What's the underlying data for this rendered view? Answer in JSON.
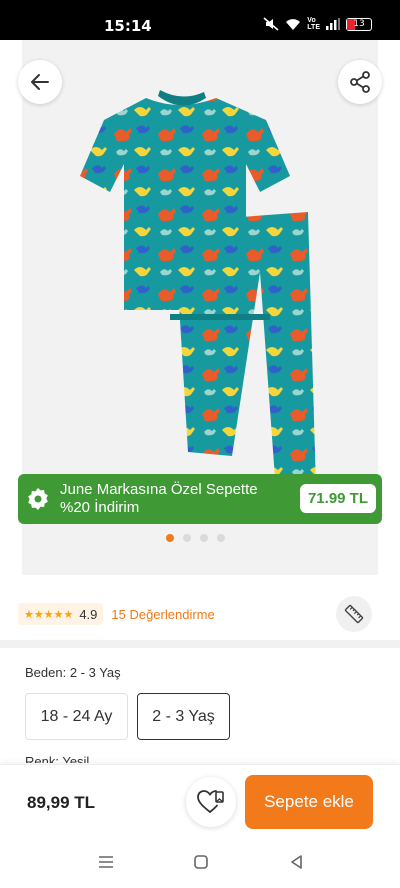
{
  "status_bar": {
    "time": "15:14",
    "battery": "13"
  },
  "product_image": {
    "description_icons": [
      "back-arrow-icon",
      "share-icon"
    ],
    "carousel": {
      "count": 4,
      "active_index": 0
    }
  },
  "promo": {
    "text": "June Markasına Özel Sepette %20 İndirim",
    "price": "71.99 TL",
    "icon": "discount-badge-icon"
  },
  "rating": {
    "stars": "★★★★★",
    "score": "4.9",
    "reviews_label": "15 Değerlendirme"
  },
  "size_section": {
    "label": "Beden: 2 - 3 Yaş",
    "options": [
      {
        "label": "18 - 24 Ay",
        "selected": false
      },
      {
        "label": "2 - 3 Yaş",
        "selected": true
      }
    ]
  },
  "color_section": {
    "label": "Renk: Yeşil"
  },
  "bottom_bar": {
    "price": "89,99 TL",
    "cart_label": "Sepete ekle"
  },
  "colors": {
    "accent": "#f27a1a",
    "promo_green": "#3f9a36",
    "teal": "#169aa0"
  }
}
